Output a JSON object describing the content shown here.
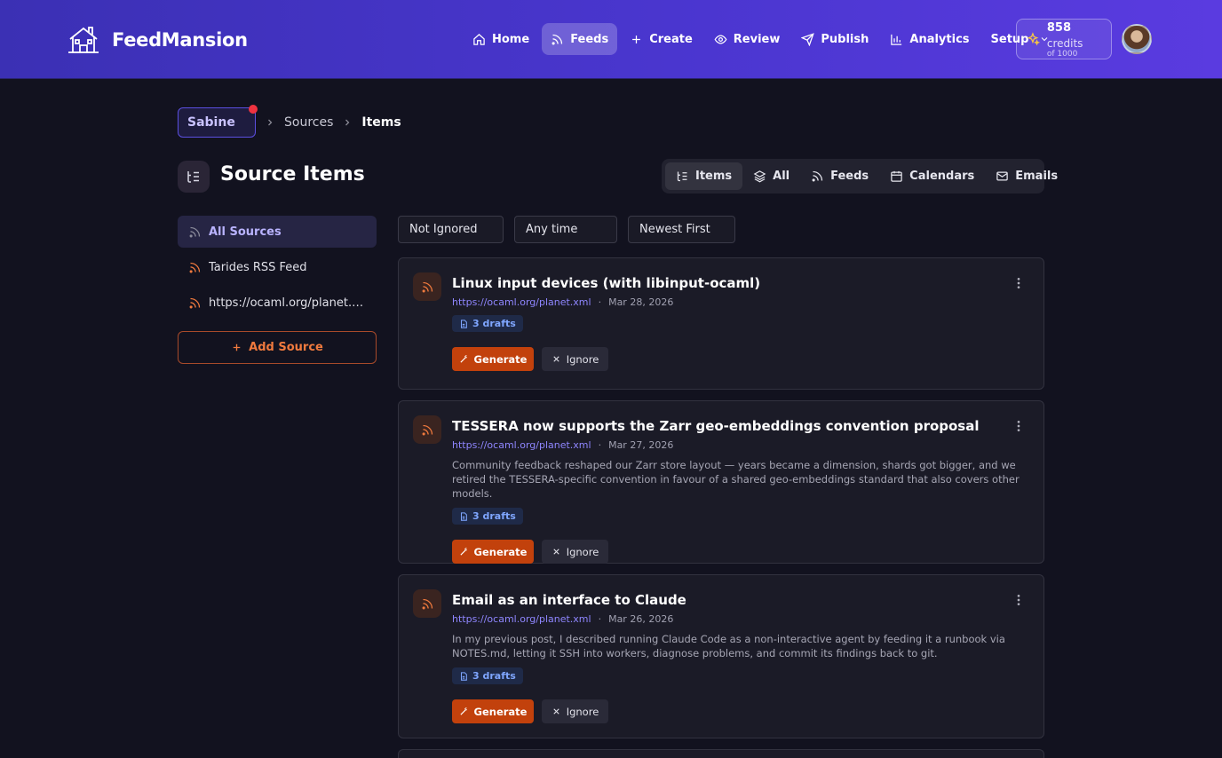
{
  "app": {
    "name": "FeedMansion"
  },
  "nav": {
    "items": [
      {
        "label": "Home",
        "icon": "home-icon"
      },
      {
        "label": "Feeds",
        "icon": "rss-icon",
        "active": true
      },
      {
        "label": "Create",
        "icon": "plus-icon"
      },
      {
        "label": "Review",
        "icon": "eye-icon"
      },
      {
        "label": "Publish",
        "icon": "send-icon"
      },
      {
        "label": "Analytics",
        "icon": "bar-chart-icon"
      },
      {
        "label": "Setup",
        "icon": "chevron-down-icon"
      }
    ],
    "credits": {
      "value": "858",
      "unit": "credits",
      "total": "of 1000"
    }
  },
  "breadcrumb": {
    "workspace": "Sabine",
    "items": [
      "Sources",
      "Items"
    ]
  },
  "page": {
    "title": "Source Items"
  },
  "view_tabs": [
    {
      "label": "Items",
      "icon": "list-tree-icon",
      "active": true
    },
    {
      "label": "All",
      "icon": "layers-icon"
    },
    {
      "label": "Feeds",
      "icon": "rss-icon"
    },
    {
      "label": "Calendars",
      "icon": "calendar-icon"
    },
    {
      "label": "Emails",
      "icon": "mail-icon"
    }
  ],
  "sidebar": {
    "items": [
      {
        "label": "All Sources",
        "active": true
      },
      {
        "label": "Tarides RSS Feed"
      },
      {
        "label": "https://ocaml.org/planet.xml"
      }
    ],
    "add_label": "Add Source"
  },
  "filters": {
    "status": "Not Ignored",
    "time": "Any time",
    "sort": "Newest First"
  },
  "items": [
    {
      "title": "Linux input devices (with libinput-ocaml)",
      "url": "https://ocaml.org/planet.xml",
      "date": "Mar 28, 2026",
      "desc": "",
      "drafts": "3 drafts",
      "generate": "Generate",
      "ignore": "Ignore"
    },
    {
      "title": "TESSERA now supports the Zarr geo-embeddings convention proposal",
      "url": "https://ocaml.org/planet.xml",
      "date": "Mar 27, 2026",
      "desc": "Community feedback reshaped our Zarr store layout — years became a dimension, shards got bigger, and we retired the TESSERA-specific convention in favour of a shared geo-embeddings standard that also covers other models.",
      "drafts": "3 drafts",
      "generate": "Generate",
      "ignore": "Ignore"
    },
    {
      "title": "Email as an interface to Claude",
      "url": "https://ocaml.org/planet.xml",
      "date": "Mar 26, 2026",
      "desc": "In my previous post, I described running Claude Code as a non-interactive agent by feeding it a runbook via NOTES.md, letting it SSH into workers, diagnose problems, and commit its findings back to git.",
      "drafts": "3 drafts",
      "generate": "Generate",
      "ignore": "Ignore"
    }
  ],
  "colors": {
    "accent": "#4a36cf",
    "orange": "#c2410c",
    "background": "#12121f"
  }
}
